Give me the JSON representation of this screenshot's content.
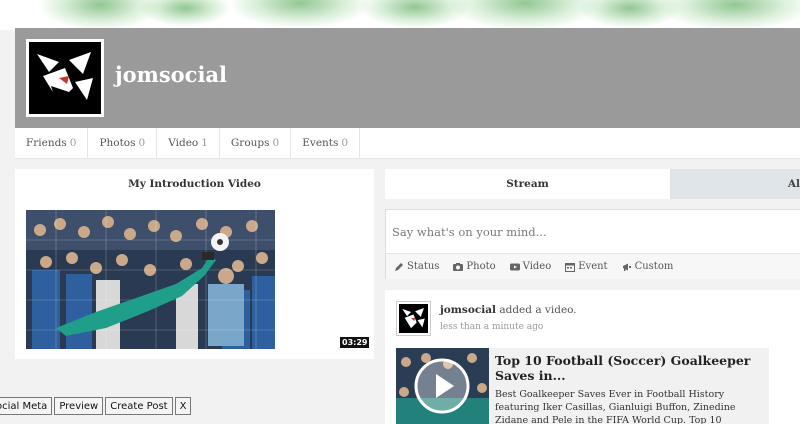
{
  "profile": {
    "name": "jomsocial",
    "avatar_icon": "wolf-logo-icon"
  },
  "nav": [
    {
      "label": "Friends",
      "count": "0"
    },
    {
      "label": "Photos",
      "count": "0"
    },
    {
      "label": "Video",
      "count": "1"
    },
    {
      "label": "Groups",
      "count": "0"
    },
    {
      "label": "Events",
      "count": "0"
    }
  ],
  "intro": {
    "title": "My Introduction Video",
    "duration": "03:29"
  },
  "toolbar": {
    "social_meta": "ocial Meta",
    "preview": "Preview",
    "create_post": "Create Post",
    "close": "X"
  },
  "stream": {
    "tab_active": "Stream",
    "tab_other": "Al",
    "composer_placeholder": "Say what's on your mind...",
    "actions": {
      "status": "Status",
      "photo": "Photo",
      "video": "Video",
      "event": "Event",
      "custom": "Custom"
    }
  },
  "post": {
    "author": "jomsocial",
    "action": "added a video.",
    "time": "less than a minute ago",
    "video_title": "Top 10 Football (Soccer) Goalkeeper Saves in...",
    "video_desc": "Best Goalkeeper Saves Ever in Football History featuring Iker Casillas, Gianluigi Buffon, Zinedine Zidane and Pele in the FIFA World Cup. Top 10"
  },
  "colors": {
    "cover": "#9a9a9a",
    "keeper_kit": "#1f9e8a",
    "tab_inactive": "#dfe5e8"
  }
}
